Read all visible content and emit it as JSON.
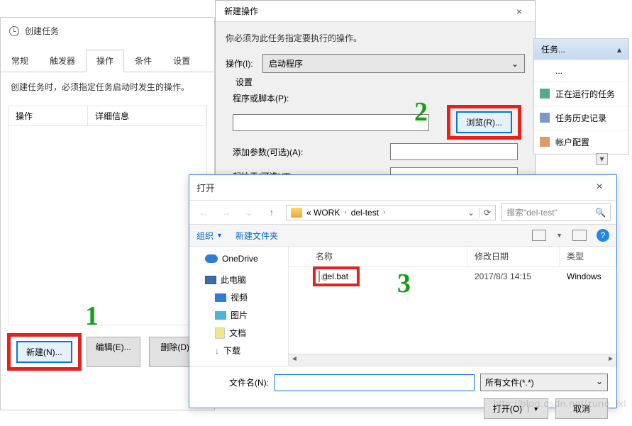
{
  "task_window": {
    "title": "创建任务",
    "tabs": [
      "常规",
      "触发器",
      "操作",
      "条件",
      "设置"
    ],
    "active_tab": 2,
    "note": "创建任务时，必须指定任务启动时发生的操作。",
    "col_action": "操作",
    "col_detail": "详细信息",
    "btn_new": "新建(N)...",
    "btn_edit": "编辑(E)...",
    "btn_delete": "删除(D)"
  },
  "action_dialog": {
    "title": "新建操作",
    "instruction": "你必须为此任务指定要执行的操作。",
    "action_label": "操作(I):",
    "action_value": "启动程序",
    "settings_label": "设置",
    "program_label": "程序或脚本(P):",
    "browse_btn": "浏览(R)...",
    "args_label": "添加参数(可选)(A):",
    "start_in_label": "起始于(可选)(T):"
  },
  "side_pane": {
    "header": "任务...",
    "items": [
      "...",
      "正在运行的任务",
      "任务历史记录",
      "帐户配置"
    ]
  },
  "open_dialog": {
    "title": "打开",
    "breadcrumb_root": "« WORK",
    "breadcrumb_folder": "del-test",
    "search_placeholder": "搜索\"del-test\"",
    "organize": "组织",
    "new_folder": "新建文件夹",
    "tree": {
      "onedrive": "OneDrive",
      "thispc": "此电脑",
      "video": "视频",
      "pictures": "图片",
      "docs": "文档",
      "downloads": "下载"
    },
    "col_name": "名称",
    "col_date": "修改日期",
    "col_type": "类型",
    "file": {
      "name": "del.bat",
      "date": "2017/8/3 14:15",
      "type": "Windows"
    },
    "filename_label": "文件名(N):",
    "filter": "所有文件(*.*)",
    "btn_open": "打开(O)",
    "btn_cancel": "取消"
  },
  "annotations": {
    "a1": "1",
    "a2": "2",
    "a3": "3"
  },
  "watermark": "http://blog.csdn.net/zuno_lxl"
}
